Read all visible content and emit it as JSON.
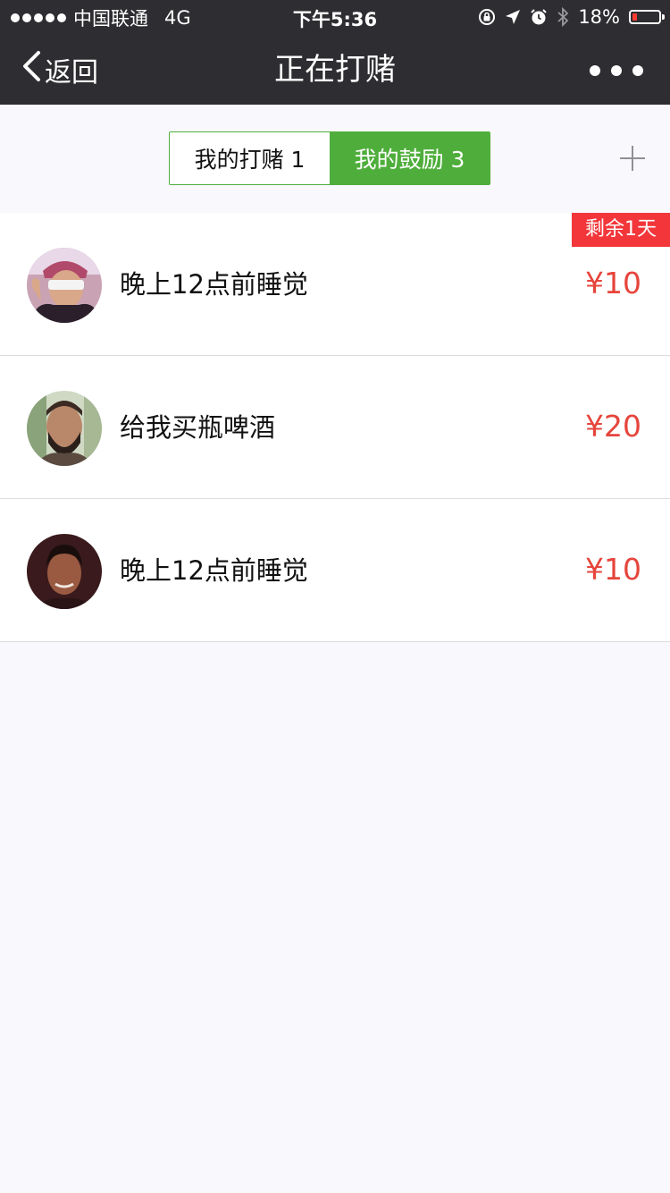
{
  "status_bar": {
    "carrier": "中国联通",
    "network": "4G",
    "time": "下午5:36",
    "battery_percent": "18%",
    "battery_level": 0.18,
    "battery_color": "#ff3b30",
    "icons": [
      "signal-dots-icon",
      "orientation-lock-icon",
      "location-arrow-icon",
      "alarm-clock-icon",
      "bluetooth-icon",
      "battery-icon"
    ]
  },
  "nav": {
    "back_label": "返回",
    "title": "正在打赌",
    "more_icon": "more-dots-icon"
  },
  "segments": {
    "left_label": "我的打赌 1",
    "right_label": "我的鼓励 3",
    "active": "right",
    "active_color": "#4fae3b",
    "add_icon": "plus-icon"
  },
  "items": [
    {
      "title": "晚上12点前睡觉",
      "amount": "¥10",
      "badge": "剩余1天",
      "avatar_icon": "avatar-photo"
    },
    {
      "title": "给我买瓶啤酒",
      "amount": "¥20",
      "badge": "",
      "avatar_icon": "avatar-photo"
    },
    {
      "title": "晚上12点前睡觉",
      "amount": "¥10",
      "badge": "",
      "avatar_icon": "avatar-photo"
    }
  ],
  "colors": {
    "bar_background": "#2e2d31",
    "amount": "#e6453c",
    "badge": "#f2363a",
    "page_background": "#f9f8fd"
  }
}
